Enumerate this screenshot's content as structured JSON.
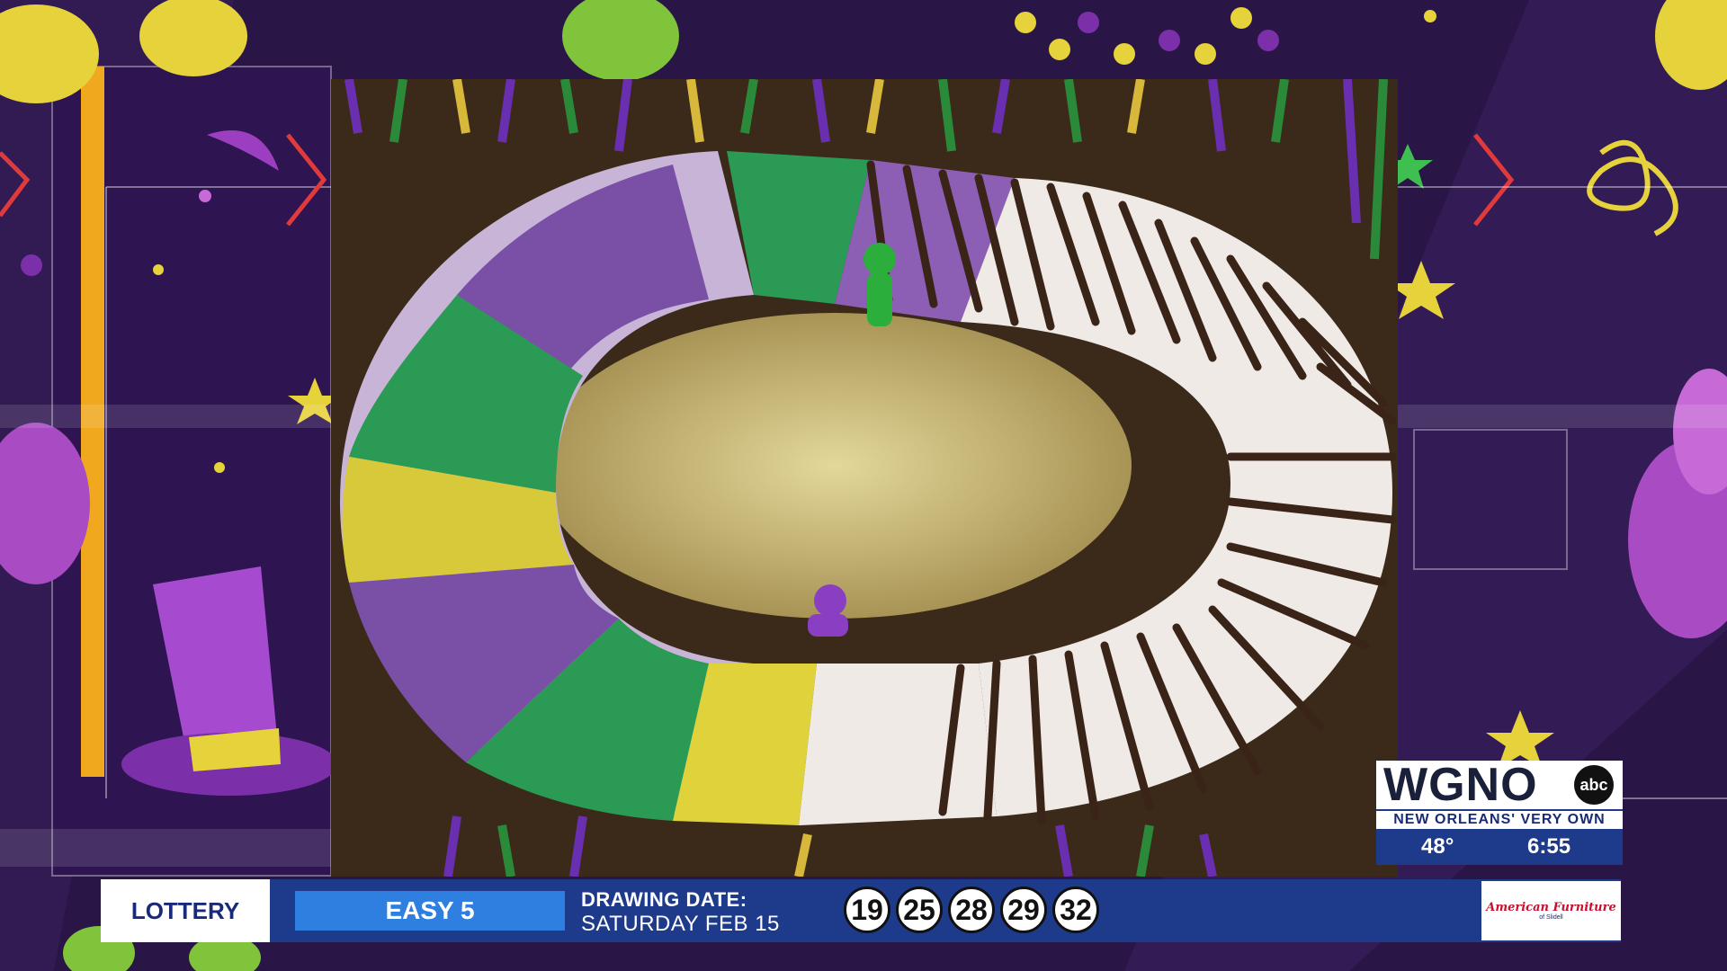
{
  "station": {
    "call_letters": "WGNO",
    "network": "abc",
    "tagline": "NEW ORLEANS' VERY OWN",
    "temperature": "48°",
    "time": "6:55"
  },
  "lottery": {
    "label": "LOTTERY",
    "game": "EASY 5",
    "drawing_date_label": "DRAWING DATE:",
    "drawing_date": "SATURDAY FEB 15",
    "numbers": [
      "19",
      "25",
      "28",
      "29",
      "32"
    ],
    "sponsor": "American Furniture",
    "sponsor_sub": "of Slidell"
  },
  "colors": {
    "background": "#2a1547",
    "purple": "#7b2fa8",
    "green": "#1f8a3c",
    "gold": "#e6d23a",
    "bar_blue": "#1e3a8a"
  }
}
